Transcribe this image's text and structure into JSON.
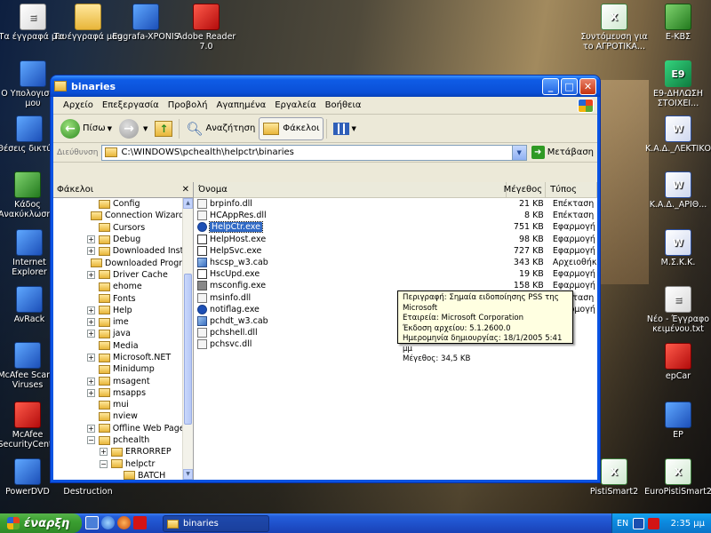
{
  "desktop_icons": [
    {
      "id": "my-docs-1",
      "label": "Τα έγγραφά μου",
      "kind": "doc"
    },
    {
      "id": "my-docs-2",
      "label": "Τα έγγραφά μου",
      "kind": "fold"
    },
    {
      "id": "eggrafa",
      "label": "Eggrafa-XPONIS",
      "kind": "blue"
    },
    {
      "id": "adobe",
      "label": "Adobe Reader 7.0",
      "kind": "red"
    },
    {
      "id": "my-computer",
      "label": "Ο Υπολογιστής μου",
      "kind": "blue"
    },
    {
      "id": "network",
      "label": "Θέσεις δικτύου",
      "kind": "blue"
    },
    {
      "id": "recycle",
      "label": "Κάδος Ανακύκλωσης",
      "kind": "green"
    },
    {
      "id": "ie",
      "label": "Internet Explorer",
      "kind": "blue"
    },
    {
      "id": "avrack",
      "label": "AvRack",
      "kind": "blue"
    },
    {
      "id": "mcafee-scan",
      "label": "McAfee Scan f Viruses",
      "kind": "blue"
    },
    {
      "id": "mcafee-sc",
      "label": "McAfee SecurityCente",
      "kind": "red"
    },
    {
      "id": "powerdvd",
      "label": "PowerDVD",
      "kind": "blue"
    },
    {
      "id": "destruction",
      "label": "Destruction",
      "kind": "blue"
    },
    {
      "id": "syntomeusi",
      "label": "Συντόμευση για το ΑΓΡΟΤΙΚΑ...",
      "kind": "excel"
    },
    {
      "id": "ekbs",
      "label": "Ε-ΚΒΣ",
      "kind": "green"
    },
    {
      "id": "e9",
      "label": "Ε9-ΔΗΛΩΣΗ ΣΤΟΙΧΕΙ...",
      "kind": "e9"
    },
    {
      "id": "kad-lektiko",
      "label": "Κ.Α.Δ._ΛΕΚΤΙΚΟ",
      "kind": "word"
    },
    {
      "id": "kad-arith",
      "label": "Κ.Α.Δ._ΑΡΙΘ...",
      "kind": "word"
    },
    {
      "id": "mskk",
      "label": "Μ.Σ.Κ.Κ.",
      "kind": "word"
    },
    {
      "id": "neo-txt",
      "label": "Νέο - Έγγραφο κειμένου.txt",
      "kind": "doc"
    },
    {
      "id": "epcar",
      "label": "epCar",
      "kind": "red"
    },
    {
      "id": "ep",
      "label": "EP",
      "kind": "blue"
    },
    {
      "id": "pistismart2a",
      "label": "PistiSmart2",
      "kind": "excel"
    },
    {
      "id": "europisti",
      "label": "EuroPistiSmart2",
      "kind": "excel"
    }
  ],
  "window": {
    "title": "binaries",
    "menu": [
      "Αρχείο",
      "Επεξεργασία",
      "Προβολή",
      "Αγαπημένα",
      "Εργαλεία",
      "Βοήθεια"
    ],
    "toolbar": {
      "back": "Πίσω",
      "search": "Αναζήτηση",
      "folders": "Φάκελοι"
    },
    "address_label": "Διεύθυνση",
    "address": "C:\\WINDOWS\\pchealth\\helpctr\\binaries",
    "go": "Μετάβαση",
    "folders_pane_title": "Φάκελοι",
    "tree": [
      {
        "label": "Config",
        "depth": 0,
        "pm": ""
      },
      {
        "label": "Connection Wizard",
        "depth": 0,
        "pm": ""
      },
      {
        "label": "Cursors",
        "depth": 0,
        "pm": ""
      },
      {
        "label": "Debug",
        "depth": 0,
        "pm": "+"
      },
      {
        "label": "Downloaded Installat",
        "depth": 0,
        "pm": "+"
      },
      {
        "label": "Downloaded Program",
        "depth": 0,
        "pm": ""
      },
      {
        "label": "Driver Cache",
        "depth": 0,
        "pm": "+"
      },
      {
        "label": "ehome",
        "depth": 0,
        "pm": ""
      },
      {
        "label": "Fonts",
        "depth": 0,
        "pm": ""
      },
      {
        "label": "Help",
        "depth": 0,
        "pm": "+"
      },
      {
        "label": "ime",
        "depth": 0,
        "pm": "+"
      },
      {
        "label": "java",
        "depth": 0,
        "pm": "+"
      },
      {
        "label": "Media",
        "depth": 0,
        "pm": ""
      },
      {
        "label": "Microsoft.NET",
        "depth": 0,
        "pm": "+"
      },
      {
        "label": "Minidump",
        "depth": 0,
        "pm": ""
      },
      {
        "label": "msagent",
        "depth": 0,
        "pm": "+"
      },
      {
        "label": "msapps",
        "depth": 0,
        "pm": "+"
      },
      {
        "label": "mui",
        "depth": 0,
        "pm": ""
      },
      {
        "label": "nview",
        "depth": 0,
        "pm": ""
      },
      {
        "label": "Offline Web Pages",
        "depth": 0,
        "pm": "+"
      },
      {
        "label": "pchealth",
        "depth": 0,
        "pm": "-"
      },
      {
        "label": "ERRORREP",
        "depth": 1,
        "pm": "+"
      },
      {
        "label": "helpctr",
        "depth": 1,
        "pm": "-"
      },
      {
        "label": "BATCH",
        "depth": 2,
        "pm": ""
      },
      {
        "label": "binaries",
        "depth": 2,
        "pm": "",
        "sel": true
      },
      {
        "label": "Config",
        "depth": 2,
        "pm": "+"
      }
    ],
    "columns": {
      "name": "Όνομα",
      "size": "Μέγεθος",
      "type": "Τύπος"
    },
    "files": [
      {
        "name": "brpinfo.dll",
        "size": "21 KB",
        "type": "Επέκταση εφ",
        "icon": "dll"
      },
      {
        "name": "HCAppRes.dll",
        "size": "8 KB",
        "type": "Επέκταση εφ",
        "icon": "dll"
      },
      {
        "name": "HelpCtr.exe",
        "size": "751 KB",
        "type": "Εφαρμογή",
        "icon": "help",
        "sel": true
      },
      {
        "name": "HelpHost.exe",
        "size": "98 KB",
        "type": "Εφαρμογή",
        "icon": "exe"
      },
      {
        "name": "HelpSvc.exe",
        "size": "727 KB",
        "type": "Εφαρμογή",
        "icon": "exe"
      },
      {
        "name": "hscsp_w3.cab",
        "size": "343 KB",
        "type": "Αρχειοθήκη",
        "icon": "cab"
      },
      {
        "name": "HscUpd.exe",
        "size": "19 KB",
        "type": "Εφαρμογή",
        "icon": "exe"
      },
      {
        "name": "msconfig.exe",
        "size": "158 KB",
        "type": "Εφαρμογή",
        "icon": "cfg"
      },
      {
        "name": "msinfo.dll",
        "size": "373 KB",
        "type": "Επέκταση εφ",
        "icon": "dll"
      },
      {
        "name": "notiflag.exe",
        "size": "35 KB",
        "type": "Εφαρμογή",
        "icon": "help"
      },
      {
        "name": "pchdt_w3.cab",
        "size": "",
        "type": "",
        "icon": "cab"
      },
      {
        "name": "pchshell.dll",
        "size": "",
        "type": "",
        "icon": "dll"
      },
      {
        "name": "pchsvc.dll",
        "size": "",
        "type": "",
        "icon": "dll"
      }
    ],
    "tooltip": [
      "Περιγραφή: Σημαία ειδοποίησης PSS της Microsoft",
      "Εταιρεία: Microsoft Corporation",
      "Έκδοση αρχείου: 5.1.2600.0",
      "Ημερομηνία δημιουργίας: 18/1/2005 5:41 μμ",
      "Μέγεθος: 34,5 KB"
    ]
  },
  "taskbar": {
    "start": "έναρξη",
    "task": "binaries",
    "lang": "EN",
    "clock": "2:35 μμ"
  }
}
